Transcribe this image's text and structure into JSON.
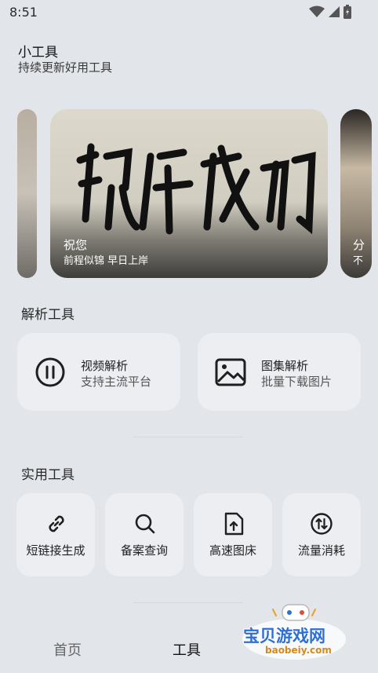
{
  "status_bar": {
    "time": "8:51",
    "icons": [
      "wifi-icon",
      "signal-icon",
      "battery-icon"
    ]
  },
  "header": {
    "title": "小工具",
    "subtitle": "持续更新好用工具"
  },
  "carousel": {
    "main": {
      "calligraphy": "祝你成功",
      "title": "祝您",
      "subtitle": "前程似锦 早日上岸"
    },
    "right_peek": {
      "title": "分",
      "subtitle": "不"
    }
  },
  "parse_section": {
    "title": "解析工具",
    "cards": [
      {
        "label": "视频解析",
        "sub": "支持主流平台",
        "icon": "pause-circle-icon"
      },
      {
        "label": "图集解析",
        "sub": "批量下载图片",
        "icon": "image-icon"
      }
    ]
  },
  "utility_section": {
    "title": "实用工具",
    "tiles": [
      {
        "label": "短链接生成",
        "icon": "link-icon"
      },
      {
        "label": "备案查询",
        "icon": "search-icon"
      },
      {
        "label": "高速图床",
        "icon": "upload-file-icon"
      },
      {
        "label": "流量消耗",
        "icon": "swap-vertical-icon"
      }
    ]
  },
  "bottom_nav": {
    "items": [
      {
        "label": "首页",
        "active": false
      },
      {
        "label": "工具",
        "active": true
      }
    ]
  },
  "watermark": {
    "text": "宝贝游戏网",
    "url": "baobeiy.com"
  },
  "colors": {
    "background": "#e2e5ea",
    "card": "#eceef2",
    "watermark_blue": "#2c6fd6"
  }
}
